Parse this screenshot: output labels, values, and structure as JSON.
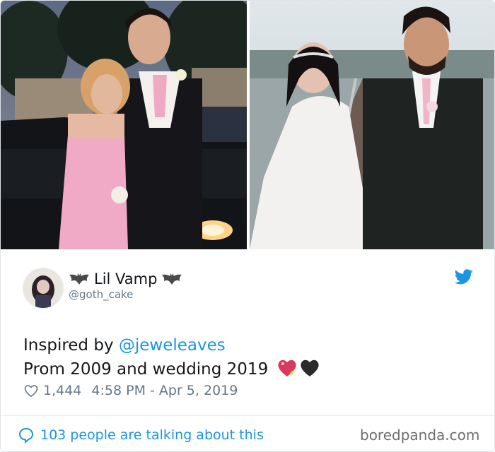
{
  "tweet": {
    "display_name": "Lil Vamp",
    "handle": "@goth_cake",
    "text_prefix": "Inspired by ",
    "mention": "@jeweleaves",
    "text_line2": "Prom 2009 and wedding 2019",
    "likes": "1,444",
    "timestamp": "4:58 PM - Apr 5, 2019",
    "conversation": "103 people are talking about this"
  },
  "icons": {
    "bat": "bat-icon",
    "twitter": "twitter-bird-icon",
    "heart": "heart-outline-icon",
    "bubble": "speech-bubble-icon",
    "emoji_1": "sparkling-heart-emoji",
    "emoji_2": "black-heart-emoji"
  },
  "colors": {
    "link": "#1b95e0",
    "text": "#14171a",
    "muted": "#657786"
  },
  "watermark": "boredpanda.com"
}
